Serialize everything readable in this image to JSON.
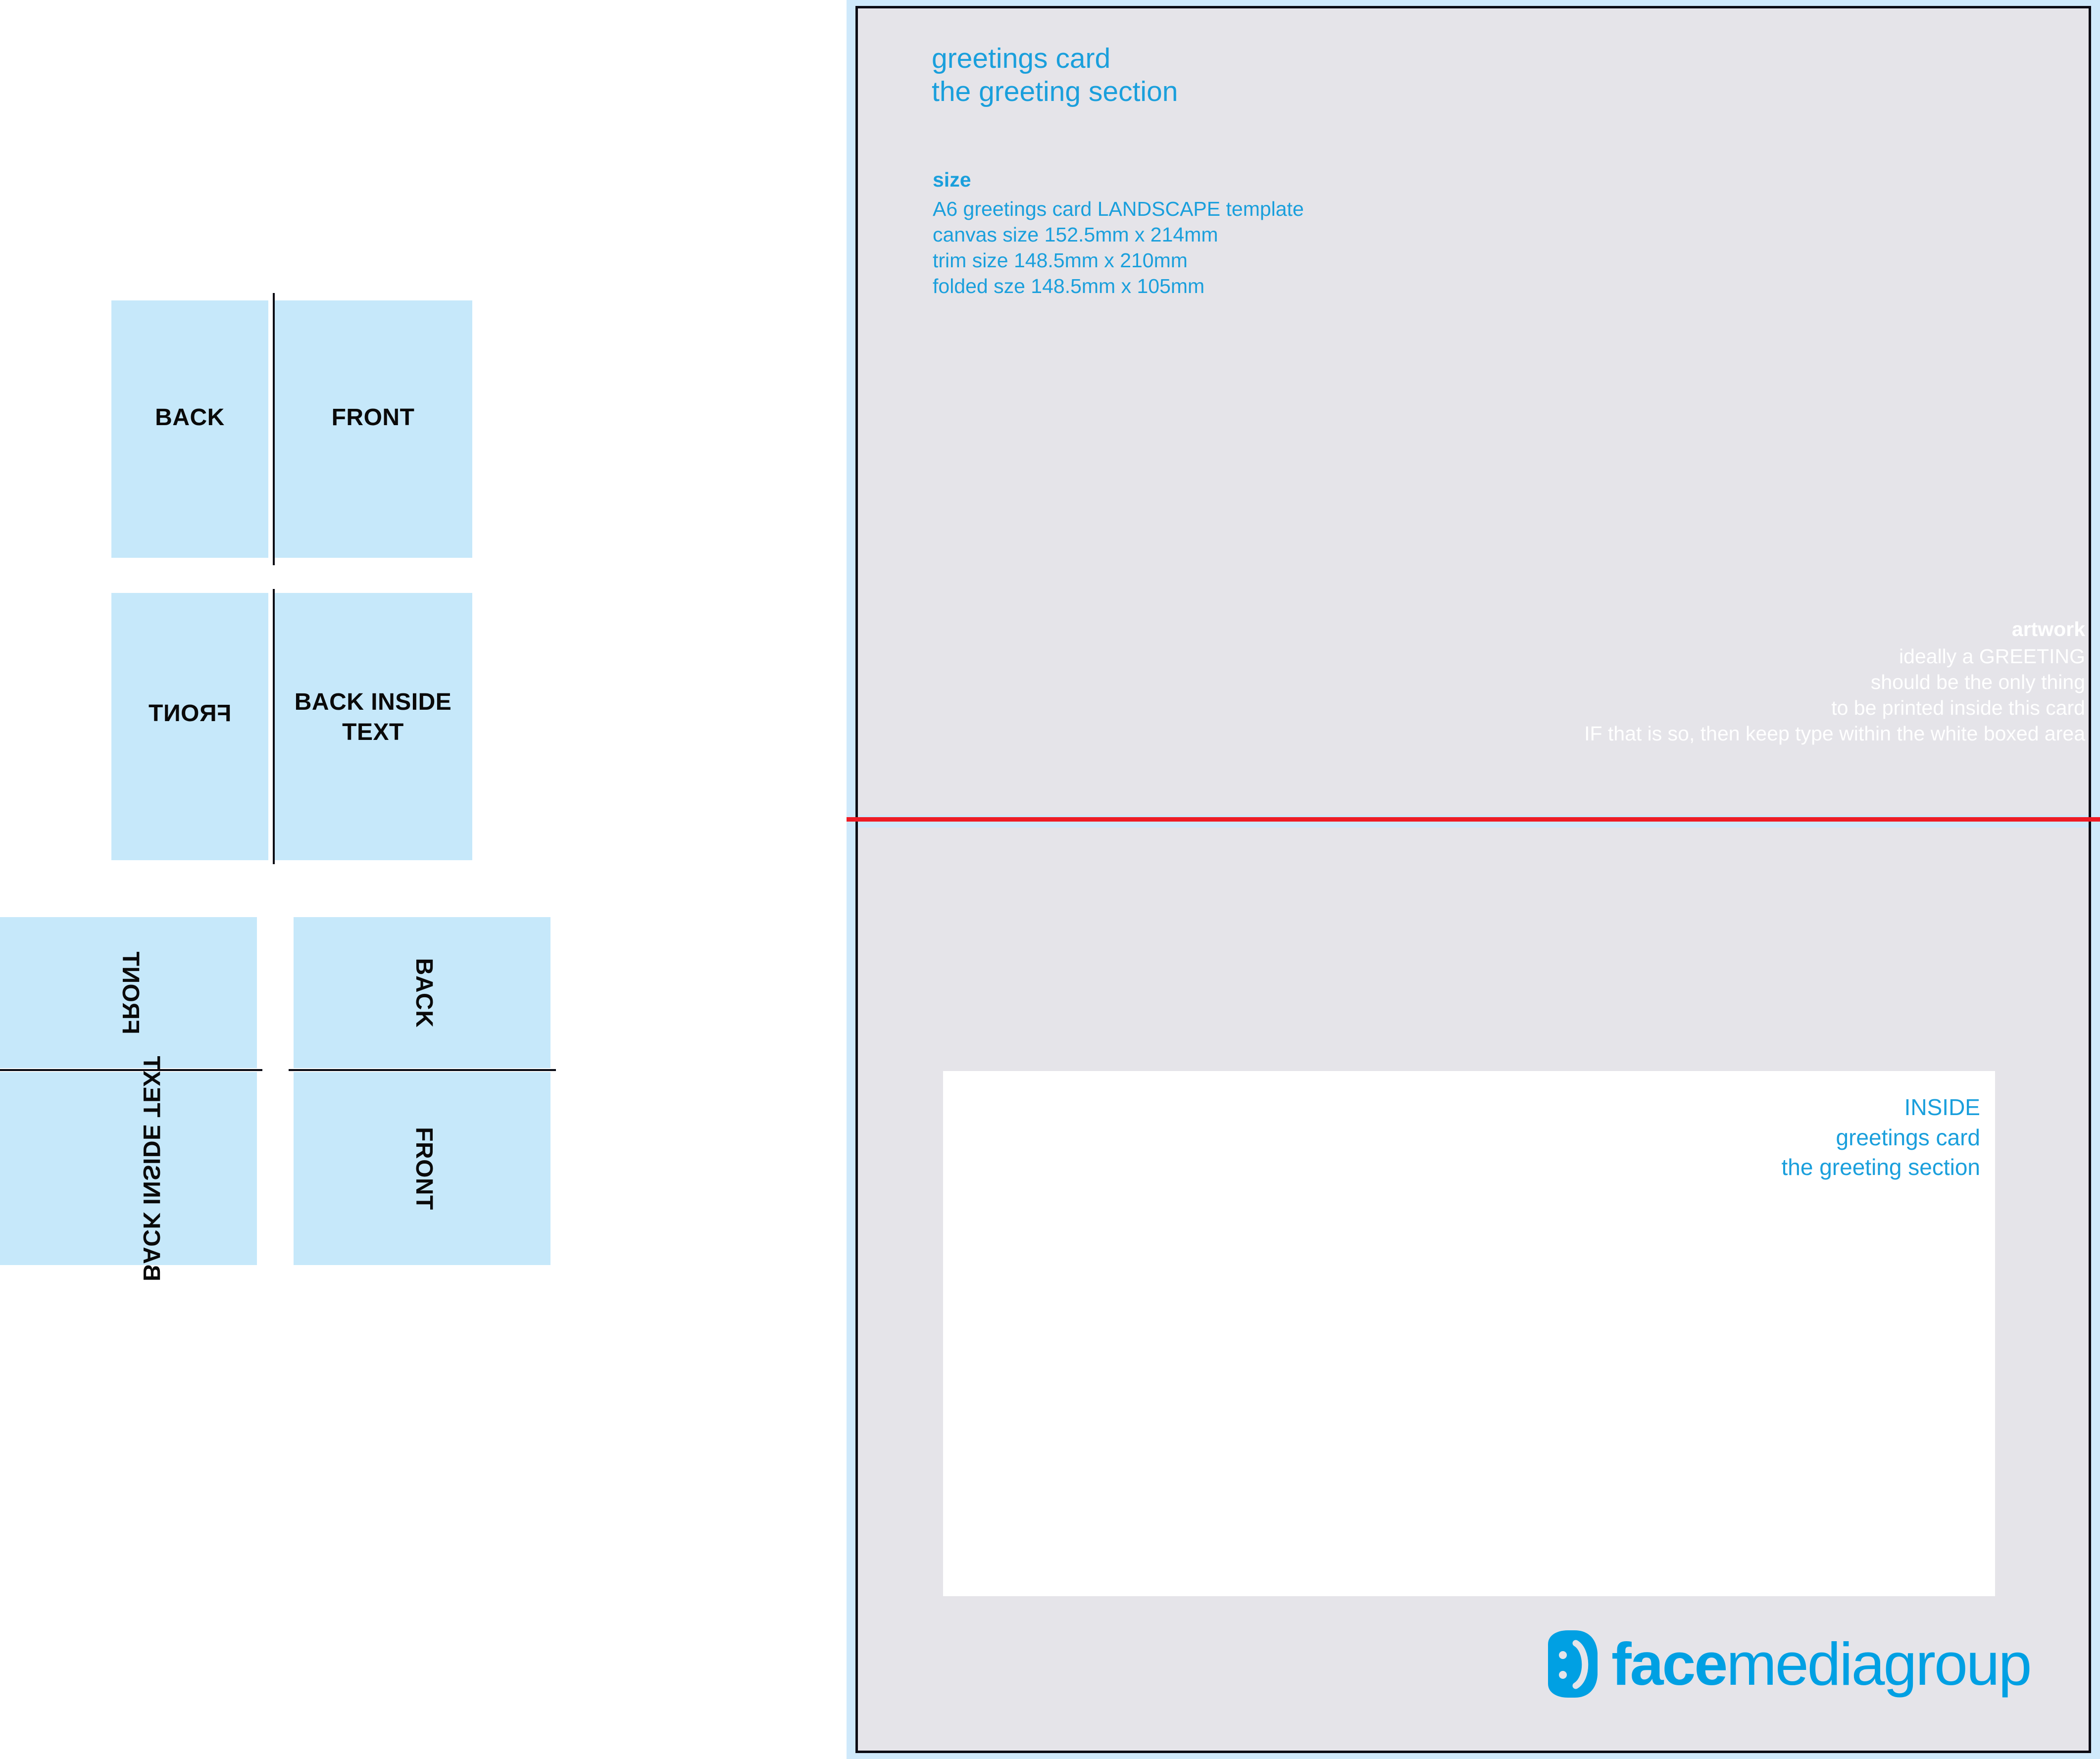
{
  "colors": {
    "brand_blue": "#1a9fdc",
    "logo_blue": "#00a0e3",
    "panel_blue": "#c6e8fa",
    "bleed_blue": "#cfe9fb",
    "card_gray": "#e5e4e9",
    "fold_red": "#ee1c25",
    "trim_black": "#0b0b14",
    "artwork_white": "#ffffff"
  },
  "fold_diagrams": {
    "diagram_flat": {
      "back_label": "BACK",
      "front_label": "FRONT"
    },
    "diagram_inside": {
      "front_label": "FRONT",
      "back_inside_label": "BACK\nINSIDE\nTEXT"
    },
    "diagram_rotated": {
      "left_front_label": "FRONT",
      "left_back_inside_label": "BACK\nINSIDE\nTEXT",
      "right_back_label": "BACK",
      "right_front_label": "FRONT"
    }
  },
  "artboard": {
    "spec_title": "greetings card\nthe greeting section",
    "size_heading": "size",
    "size_lines": "A6 greetings card LANDSCAPE template\ncanvas size 152.5mm x 214mm\ntrim size 148.5mm x 210mm\nfolded sze 148.5mm x 105mm",
    "artwork_heading": "artwork",
    "artwork_lines": "ideally a GREETING\nshould be the only thing\nto be printed inside this card\nIF that is so, then keep type within the white boxed area",
    "inside_text": "INSIDE\ngreetings card\nthe greeting section"
  },
  "logo": {
    "icon_name": "smiley-face-icon",
    "word_bold": "face",
    "word_light": "mediagroup"
  }
}
